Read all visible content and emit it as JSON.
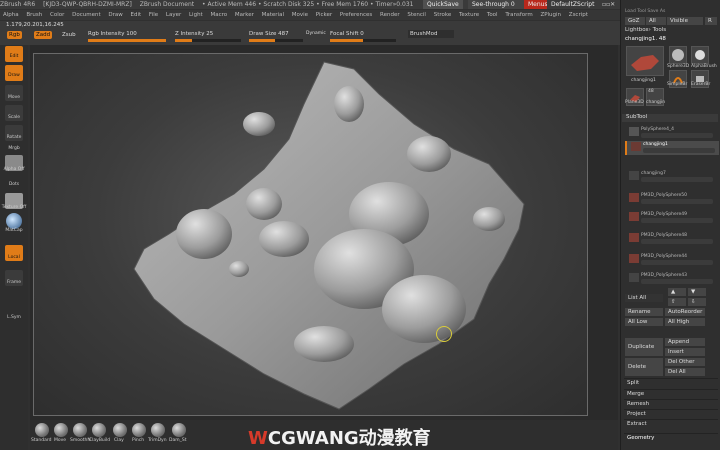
{
  "title_bar": {
    "items": [
      "ZBrush 4R6",
      "[KJD3-QWP-QBRH-DZMI-MRZ]",
      "ZBrush Document",
      "• Active Mem 446 • Scratch Disk 325 • Free Mem 1760 • Timer»0.031"
    ],
    "quicksave": "QuickSave",
    "seethrough": "See-through  0",
    "menus_btn": "Menus",
    "script": "DefaultZScript"
  },
  "menu_bar": [
    "Alpha",
    "Brush",
    "Color",
    "Document",
    "Draw",
    "Edit",
    "File",
    "Layer",
    "Light",
    "Macro",
    "Marker",
    "Material",
    "Movie",
    "Picker",
    "Preferences",
    "Render",
    "Stencil",
    "Stroke",
    "Texture",
    "Tool",
    "Transform",
    "ZPlugin",
    "Zscript"
  ],
  "toolbar": {
    "coords": "1.179,20.201,16.245",
    "rgb": "Rgb",
    "zadd": "Zadd",
    "zsub": "Zsub",
    "rgb_intensity": "Rgb Intensity 100",
    "z_intensity": "Z Intensity 25",
    "draw_size": "Draw Size 487",
    "dynamic": "Dynamic",
    "focal_shift": "Focal Shift 0",
    "brush_mod": "BrushMod",
    "rgb_intensity_value": 1.0,
    "z_intensity_value": 0.25,
    "draw_size_value": 0.49,
    "focal_shift_value": 0.5
  },
  "left_shelf": {
    "edit": "Edit",
    "draw": "Draw",
    "move": "Move",
    "scale": "Scale",
    "rotate": "Rotate",
    "mrgb": "Mrgb",
    "dots": "Dots",
    "alpha_off": "Alpha Off",
    "texture_off": "Texture Off",
    "matcap": "MatCap",
    "local": "Local",
    "frame": "Frame",
    "lsym": "L.Sym"
  },
  "brushes": [
    "Standard",
    "Move",
    "SmoothN",
    "ClayBuild",
    "Clay",
    "Pinch",
    "TrimDyn",
    "Dam_St"
  ],
  "logo": {
    "mark": "W",
    "text": "CGWANG动漫教育"
  },
  "right_panel": {
    "top_label": "Load Tool   Save As",
    "goz": "GoZ",
    "all": "All",
    "visible": "Visible",
    "r": "R",
    "lightbox_tools": "Lightbox› Tools",
    "tool_name": "changjing1. 48",
    "thumbs": [
      "changjing1",
      "Sphere3D",
      "AlphaBrush",
      "SimpleBr",
      "EraserBr",
      "Plane3D",
      "changjin"
    ],
    "thumb_number": "48",
    "subtool_header": "SubTool",
    "subtools": [
      "PolySphere4_4",
      "changjing1",
      "changjing7",
      "PM3D_PolySphere50",
      "PM3D_PolySphere49",
      "PM3D_PolySphere48",
      "PM3D_PolySphere44",
      "PM3D_PolySphere43"
    ],
    "list_all": "List All",
    "rename": "Rename",
    "autoreorder": "AutoReorder",
    "all_low": "All Low",
    "all_high": "All High",
    "duplicate": "Duplicate",
    "append": "Append",
    "insert": "Insert",
    "delete": "Delete",
    "del_other": "Del Other",
    "del_all": "Del All",
    "sections": [
      "Split",
      "Merge",
      "Remesh",
      "Project",
      "Extract",
      "Geometry"
    ]
  },
  "colors": {
    "accent": "#e07c18",
    "panel": "#2f2f2f",
    "red": "#d63a2a"
  }
}
